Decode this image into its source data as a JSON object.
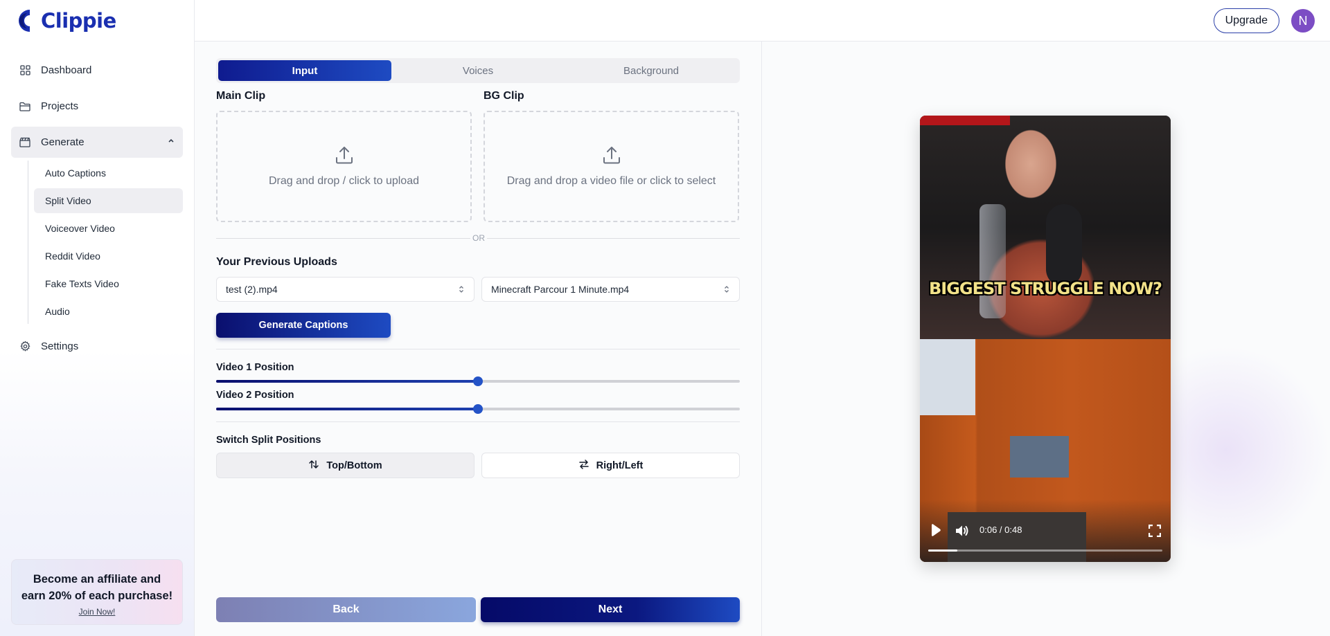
{
  "app": {
    "brand": "Clippie"
  },
  "sidebar": {
    "items": [
      {
        "label": "Dashboard",
        "icon": "grid-icon"
      },
      {
        "label": "Projects",
        "icon": "folder-icon"
      },
      {
        "label": "Generate",
        "icon": "clapperboard-icon",
        "expanded": true
      },
      {
        "label": "Settings",
        "icon": "gear-icon"
      }
    ],
    "generate_sub": [
      "Auto Captions",
      "Split Video",
      "Voiceover Video",
      "Reddit Video",
      "Fake Texts Video",
      "Audio"
    ],
    "active_sub": "Split Video"
  },
  "affiliate": {
    "line1": "Become an affiliate and",
    "line2": "earn 20% of each purchase!",
    "link": "Join Now!"
  },
  "header": {
    "upgrade": "Upgrade",
    "avatar_initial": "N"
  },
  "tabs": [
    {
      "label": "Input",
      "active": true
    },
    {
      "label": "Voices",
      "active": false
    },
    {
      "label": "Background",
      "active": false
    }
  ],
  "main_clip": {
    "label": "Main Clip",
    "drop_text": "Drag and drop / click to upload"
  },
  "bg_clip": {
    "label": "BG Clip",
    "drop_text": "Drag and drop a video file or click to select"
  },
  "or_text": "OR",
  "previous_uploads": {
    "label": "Your Previous Uploads",
    "main_selected": "test (2).mp4",
    "bg_selected": "Minecraft Parcour 1 Minute.mp4"
  },
  "generate_button": "Generate Captions",
  "sliders": [
    {
      "label": "Video 1 Position",
      "value_percent": 50
    },
    {
      "label": "Video 2 Position",
      "value_percent": 50
    }
  ],
  "switch": {
    "label": "Switch Split Positions",
    "top_bottom": "Top/Bottom",
    "right_left": "Right/Left",
    "selected": "Top/Bottom"
  },
  "footer": {
    "back": "Back",
    "next": "Next"
  },
  "video": {
    "caption": "BIGGEST STRUGGLE NOW?",
    "time": "0:06 / 0:48",
    "progress_fraction": 0.125
  },
  "colors": {
    "brand": "#1a2fb0",
    "primary_start": "#0a0f6e",
    "primary_end": "#1e4bc2",
    "avatar": "#7c4dc4"
  }
}
